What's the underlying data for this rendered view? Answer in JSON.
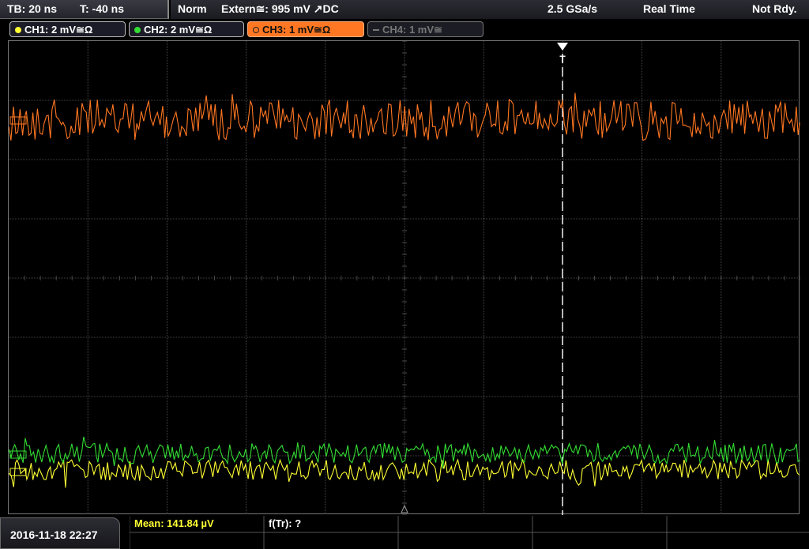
{
  "timebase": {
    "tb": "TB: 20 ns",
    "t": "T: -40 ns"
  },
  "trigger": {
    "mode": "Norm",
    "source": "Extern≅: 995 mV ↗DC",
    "sample_rate": "2.5 GSa/s",
    "acq_mode": "Real Time",
    "status": "Not Rdy."
  },
  "channels": [
    {
      "label": "CH1: 2 mV≅Ω",
      "color": "#ffff33",
      "state": "active"
    },
    {
      "label": "CH2: 2 mV≅Ω",
      "color": "#33dd33",
      "state": "active"
    },
    {
      "label": "CH3: 1 mV≅Ω",
      "color": "#ff7722",
      "state": "selected"
    },
    {
      "label": "CH4: 1 mV≅",
      "color": "#777777",
      "state": "off"
    }
  ],
  "screen": {
    "trigger_marker": "T"
  },
  "datetime": "2016-11-18 22:27",
  "measurements": {
    "mean": "Mean: 141.84 µV",
    "ftr": "f(Tr): ?"
  },
  "colors": {
    "ch1": "#ffff33",
    "ch2": "#33dd33",
    "ch3": "#ff7722",
    "grid": "#5a5a5a"
  },
  "icons": [
    "channel-dot-icon",
    "trigger-marker-icon",
    "ground-marker-icon"
  ]
}
